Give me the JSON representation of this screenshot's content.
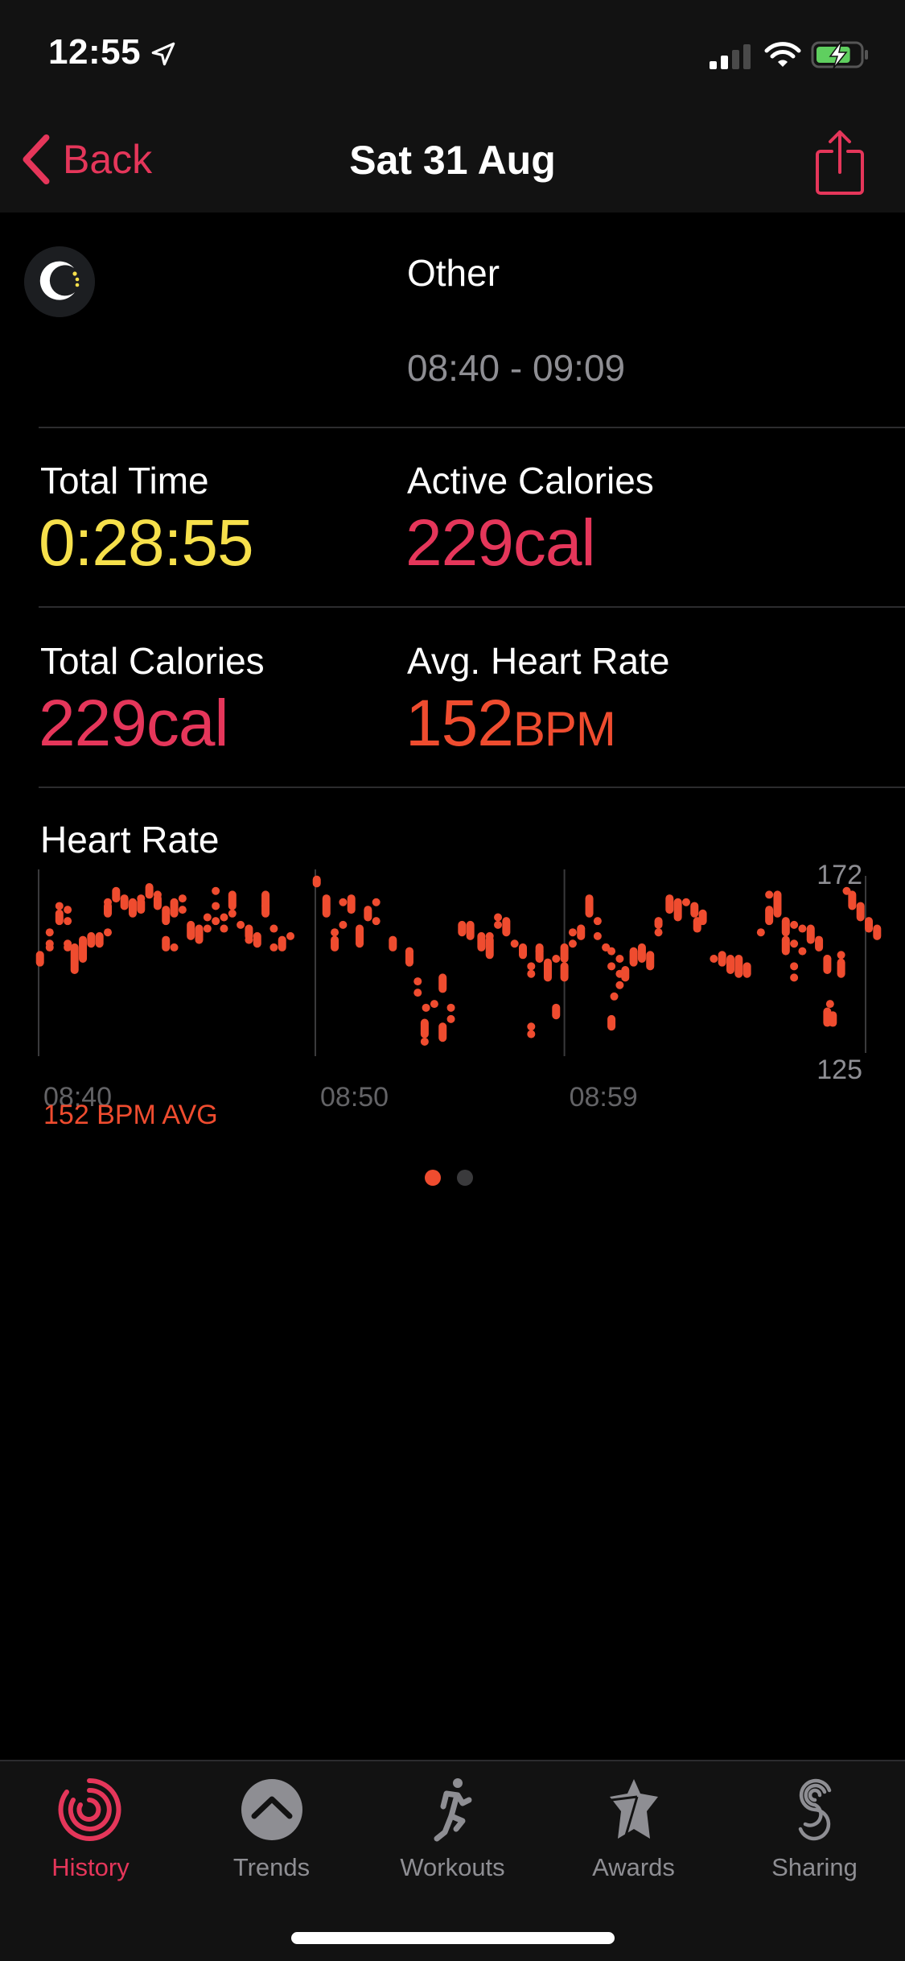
{
  "status_bar": {
    "time": "12:55",
    "location_icon": "location-arrow-icon",
    "signal_bars_active": 2,
    "signal_bars_total": 4,
    "wifi_icon": "wifi-icon",
    "battery_level": 0.8,
    "battery_charging": true
  },
  "nav": {
    "back_label": "Back",
    "title": "Sat 31 Aug",
    "share_icon": "share-icon"
  },
  "workout": {
    "icon": "other-workout-icon",
    "name": "Other",
    "time_range": "08:40 - 09:09"
  },
  "metrics": [
    {
      "label": "Total Time",
      "value": "0:28:55",
      "unit": "",
      "color": "#f6e04b"
    },
    {
      "label": "Active Calories",
      "value": "229",
      "unit": "cal",
      "color": "#e5365a"
    },
    {
      "label": "Total Calories",
      "value": "229",
      "unit": "cal",
      "color": "#e5365a"
    },
    {
      "label": "Avg. Heart Rate",
      "value": "152",
      "unit": "BPM",
      "color": "#ef4c2f"
    }
  ],
  "heart_rate": {
    "title": "Heart Rate",
    "avg_label": "152 BPM AVG",
    "color": "#ef4c2f"
  },
  "chart_data": {
    "type": "scatter",
    "title": "Heart Rate",
    "xlabel": "",
    "ylabel": "BPM",
    "x_unit": "minutes since 08:40",
    "xlim": [
      0,
      29.9
    ],
    "ylim": [
      125,
      172
    ],
    "y_tick_labels": [
      "172",
      "125"
    ],
    "x_ticks": [
      {
        "label": "08:40",
        "minute": 0
      },
      {
        "label": "08:50",
        "minute": 10
      },
      {
        "label": "08:59",
        "minute": 19
      }
    ],
    "avg": 152,
    "grid": "vertical lines at x ticks",
    "series": [
      {
        "name": "Heart Rate",
        "note": "each sample is [minute, min_bpm, max_bpm]",
        "samples": [
          [
            0.05,
            149,
            151
          ],
          [
            0.4,
            157,
            157
          ],
          [
            0.4,
            154,
            154
          ],
          [
            0.4,
            153,
            153
          ],
          [
            0.75,
            164,
            164
          ],
          [
            0.75,
            160,
            162
          ],
          [
            1.05,
            163,
            163
          ],
          [
            1.05,
            160,
            160
          ],
          [
            1.05,
            154,
            154
          ],
          [
            1.05,
            153,
            153
          ],
          [
            1.3,
            147,
            153
          ],
          [
            1.6,
            150,
            155
          ],
          [
            1.9,
            154,
            156
          ],
          [
            2.2,
            154,
            156
          ],
          [
            2.5,
            157,
            157
          ],
          [
            2.5,
            162,
            164
          ],
          [
            2.5,
            165,
            165
          ],
          [
            2.8,
            166,
            168
          ],
          [
            3.1,
            164,
            166
          ],
          [
            3.4,
            162,
            165
          ],
          [
            3.7,
            163,
            165
          ],
          [
            3.7,
            166,
            166
          ],
          [
            4.0,
            167,
            169
          ],
          [
            4.3,
            164,
            166
          ],
          [
            4.3,
            167,
            167
          ],
          [
            4.6,
            160,
            163
          ],
          [
            4.6,
            153,
            155
          ],
          [
            4.9,
            153,
            153
          ],
          [
            4.9,
            162,
            165
          ],
          [
            5.2,
            163,
            163
          ],
          [
            5.2,
            166,
            166
          ],
          [
            5.5,
            156,
            159
          ],
          [
            5.8,
            155,
            158
          ],
          [
            6.1,
            158,
            158
          ],
          [
            6.1,
            161,
            161
          ],
          [
            6.4,
            160,
            160
          ],
          [
            6.4,
            164,
            164
          ],
          [
            6.4,
            168,
            168
          ],
          [
            6.7,
            161,
            161
          ],
          [
            6.7,
            158,
            158
          ],
          [
            7.0,
            164,
            167
          ],
          [
            7.0,
            162,
            162
          ],
          [
            7.3,
            159,
            159
          ],
          [
            7.6,
            156,
            158
          ],
          [
            7.6,
            155,
            155
          ],
          [
            7.9,
            154,
            156
          ],
          [
            8.2,
            164,
            167
          ],
          [
            8.2,
            162,
            164
          ],
          [
            8.5,
            158,
            158
          ],
          [
            8.5,
            153,
            153
          ],
          [
            8.8,
            153,
            155
          ],
          [
            9.1,
            156,
            156
          ],
          [
            10.05,
            170,
            171
          ],
          [
            10.4,
            162,
            166
          ],
          [
            10.7,
            157,
            157
          ],
          [
            10.7,
            153,
            155
          ],
          [
            11.0,
            165,
            165
          ],
          [
            11.0,
            159,
            159
          ],
          [
            11.3,
            163,
            166
          ],
          [
            11.6,
            154,
            158
          ],
          [
            11.9,
            161,
            163
          ],
          [
            12.2,
            165,
            165
          ],
          [
            12.2,
            160,
            160
          ],
          [
            12.8,
            153,
            155
          ],
          [
            13.4,
            149,
            152
          ],
          [
            13.4,
            152,
            152
          ],
          [
            13.7,
            144,
            144
          ],
          [
            13.7,
            141,
            141
          ],
          [
            13.95,
            130,
            133
          ],
          [
            13.95,
            128,
            128
          ],
          [
            14.0,
            137,
            137
          ],
          [
            14.3,
            138,
            138
          ],
          [
            14.6,
            142,
            145
          ],
          [
            14.6,
            129,
            132
          ],
          [
            14.9,
            137,
            137
          ],
          [
            14.9,
            134,
            134
          ],
          [
            15.3,
            157,
            159
          ],
          [
            15.6,
            156,
            159
          ],
          [
            16.0,
            153,
            156
          ],
          [
            16.3,
            151,
            155
          ],
          [
            16.3,
            156,
            156
          ],
          [
            16.6,
            161,
            161
          ],
          [
            16.6,
            159,
            159
          ],
          [
            16.9,
            157,
            160
          ],
          [
            17.2,
            154,
            154
          ],
          [
            17.5,
            151,
            153
          ],
          [
            17.8,
            148,
            148
          ],
          [
            17.8,
            146,
            146
          ],
          [
            17.8,
            132,
            132
          ],
          [
            17.8,
            130,
            130
          ],
          [
            18.1,
            150,
            153
          ],
          [
            18.1,
            152,
            152
          ],
          [
            18.4,
            145,
            149
          ],
          [
            18.7,
            150,
            150
          ],
          [
            18.7,
            135,
            137
          ],
          [
            19.0,
            150,
            153
          ],
          [
            19.0,
            145,
            148
          ],
          [
            19.3,
            157,
            157
          ],
          [
            19.3,
            154,
            154
          ],
          [
            19.6,
            156,
            158
          ],
          [
            19.6,
            158,
            158
          ],
          [
            19.9,
            162,
            166
          ],
          [
            20.2,
            160,
            160
          ],
          [
            20.2,
            156,
            156
          ],
          [
            20.5,
            153,
            153
          ],
          [
            20.5,
            153,
            153
          ],
          [
            20.7,
            152,
            152
          ],
          [
            20.7,
            148,
            148
          ],
          [
            20.7,
            132,
            134
          ],
          [
            20.8,
            140,
            140
          ],
          [
            21.0,
            143,
            143
          ],
          [
            21.0,
            146,
            146
          ],
          [
            21.0,
            150,
            150
          ],
          [
            21.2,
            145,
            147
          ],
          [
            21.5,
            149,
            152
          ],
          [
            21.8,
            150,
            153
          ],
          [
            22.1,
            148,
            151
          ],
          [
            22.4,
            159,
            160
          ],
          [
            22.4,
            157,
            157
          ],
          [
            22.8,
            163,
            166
          ],
          [
            23.1,
            161,
            165
          ],
          [
            23.4,
            165,
            165
          ],
          [
            23.7,
            162,
            164
          ],
          [
            23.8,
            158,
            160
          ],
          [
            24.0,
            160,
            162
          ],
          [
            24.4,
            150,
            150
          ],
          [
            24.7,
            149,
            151
          ],
          [
            25.0,
            147,
            150
          ],
          [
            25.3,
            146,
            150
          ],
          [
            25.6,
            146,
            148
          ],
          [
            26.1,
            157,
            157
          ],
          [
            26.4,
            160,
            163
          ],
          [
            26.4,
            167,
            167
          ],
          [
            26.7,
            162,
            167
          ],
          [
            27.0,
            157,
            160
          ],
          [
            27.0,
            152,
            155
          ],
          [
            27.3,
            159,
            159
          ],
          [
            27.3,
            154,
            154
          ],
          [
            27.3,
            148,
            148
          ],
          [
            27.3,
            145,
            145
          ],
          [
            27.6,
            158,
            158
          ],
          [
            27.6,
            152,
            152
          ],
          [
            27.9,
            155,
            158
          ],
          [
            28.2,
            153,
            155
          ],
          [
            28.5,
            147,
            150
          ],
          [
            28.5,
            150,
            150
          ],
          [
            28.6,
            138,
            138
          ],
          [
            28.5,
            133,
            136
          ],
          [
            28.7,
            133,
            135
          ],
          [
            29.0,
            151,
            151
          ],
          [
            29.0,
            146,
            149
          ],
          [
            29.2,
            168,
            168
          ],
          [
            29.4,
            164,
            167
          ],
          [
            29.7,
            161,
            164
          ],
          [
            30.0,
            158,
            160
          ],
          [
            30.3,
            156,
            158
          ]
        ]
      }
    ]
  },
  "pager": {
    "count": 2,
    "active_index": 0
  },
  "tabs": [
    {
      "label": "History",
      "icon": "history-rings-icon",
      "active": true
    },
    {
      "label": "Trends",
      "icon": "trends-chevron-icon",
      "active": false
    },
    {
      "label": "Workouts",
      "icon": "running-figure-icon",
      "active": false
    },
    {
      "label": "Awards",
      "icon": "awards-star-icon",
      "active": false
    },
    {
      "label": "Sharing",
      "icon": "sharing-s-icon",
      "active": false
    }
  ]
}
